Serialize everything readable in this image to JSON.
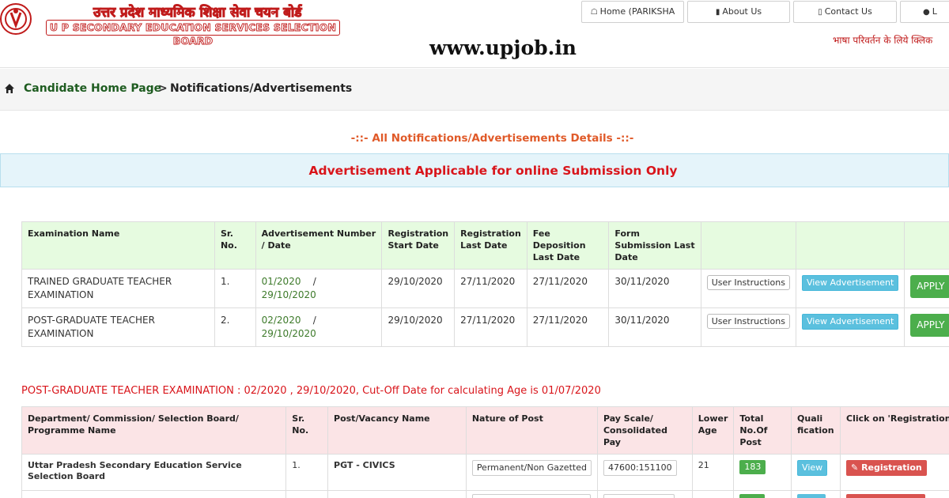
{
  "header": {
    "title_hindi": "उत्तर प्रदेश माध्यमिक शिक्षा सेवा चयन बोर्ड",
    "title_en": "U P SECONDARY EDUCATION SERVICES SELECTION BOARD",
    "site_url": "www.upjob.in",
    "lang_link": "भाषा परिवर्तन के लिये क्लिक",
    "nav": {
      "home": "Home (PARIKSHA",
      "about": "About Us",
      "contact": "Contact Us",
      "login": "L"
    }
  },
  "breadcrumb": {
    "home": "Candidate Home Page",
    "sep": ">",
    "current": "Notifications/Advertisements"
  },
  "section_title": "-::- All Notifications/Advertisements Details -::-",
  "notice": "Advertisement Applicable for online Submission Only",
  "ads_table": {
    "headers": {
      "exam": "Examination Name",
      "sr": "Sr. No.",
      "adv": "Advertisement Number / Date",
      "reg_start": "Registration Start Date",
      "reg_last": "Registration Last Date",
      "fee": "Fee Deposition Last Date",
      "form": "Form Submission Last Date"
    },
    "rows": [
      {
        "exam": "TRAINED GRADUATE TEACHER EXAMINATION",
        "sr": "1.",
        "adv_no": "01/2020",
        "adv_sep": "/",
        "adv_date": "29/10/2020",
        "reg_start": "29/10/2020",
        "reg_last": "27/11/2020",
        "fee": "27/11/2020",
        "form": "30/11/2020",
        "instr": "User Instructions",
        "view": "View Advertisement",
        "apply": "APPLY"
      },
      {
        "exam": "POST-GRADUATE TEACHER EXAMINATION",
        "sr": "2.",
        "adv_no": "02/2020",
        "adv_sep": "/",
        "adv_date": "29/10/2020",
        "reg_start": "29/10/2020",
        "reg_last": "27/11/2020",
        "fee": "27/11/2020",
        "form": "30/11/2020",
        "instr": "User Instructions",
        "view": "View Advertisement",
        "apply": "APPLY"
      }
    ]
  },
  "exam_heading": "POST-GRADUATE TEACHER EXAMINATION : 02/2020 , 29/10/2020, Cut-Off Date for calculating Age is 01/07/2020",
  "posts_table": {
    "headers": {
      "dept": "Department/ Commission/ Selection Board/ Programme Name",
      "sr": "Sr. No.",
      "post": "Post/Vacancy Name",
      "nature": "Nature of Post",
      "pay": "Pay Scale/ Consolidated Pay",
      "age": "Lower Age",
      "total": "Total No.Of Post",
      "qual": "Quali fication",
      "click": "Click on 'Registration' ↓"
    },
    "rows": [
      {
        "dept": "Uttar Pradesh Secondary Education Service Selection Board",
        "sr": "1.",
        "post": "PGT - CIVICS",
        "nature": "Permanent/Non Gazetted",
        "pay": "47600:151100",
        "age": "21",
        "total": "183",
        "qual": "View",
        "reg": "Registration"
      }
    ]
  }
}
